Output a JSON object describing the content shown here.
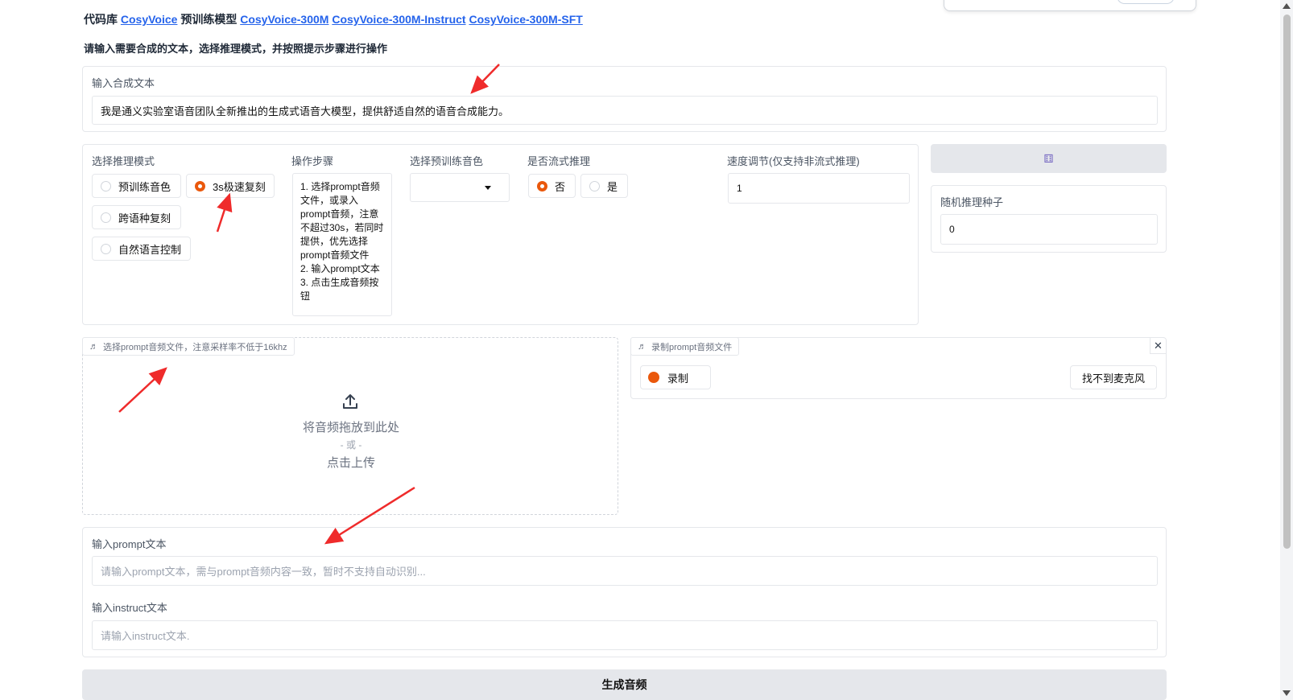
{
  "header": {
    "repo_label": "代码库",
    "repo_link": "CosyVoice",
    "models_label": "预训练模型",
    "model_links": [
      "CosyVoice-300M",
      "CosyVoice-300M-Instruct",
      "CosyVoice-300M-SFT"
    ]
  },
  "subtitle": "请输入需要合成的文本，选择推理模式，并按照提示步骤进行操作",
  "tts_text": {
    "label": "输入合成文本",
    "value": "我是通义实验室语音团队全新推出的生成式语音大模型，提供舒适自然的语音合成能力。"
  },
  "mode": {
    "label": "选择推理模式",
    "options": [
      "预训练音色",
      "3s极速复刻",
      "跨语种复刻",
      "自然语言控制"
    ],
    "selected": "3s极速复刻"
  },
  "steps": {
    "label": "操作步骤",
    "text": "1. 选择prompt音频文件，或录入prompt音频，注意不超过30s，若同时提供，优先选择prompt音频文件\n2. 输入prompt文本\n3. 点击生成音频按钮"
  },
  "voice_select": {
    "label": "选择预训练音色",
    "value": ""
  },
  "stream": {
    "label": "是否流式推理",
    "options": [
      "否",
      "是"
    ],
    "selected": "否"
  },
  "speed": {
    "label": "速度调节(仅支持非流式推理)",
    "value": "1"
  },
  "dice_button": {
    "icon": "dice-icon",
    "glyph": "⚅"
  },
  "seed": {
    "label": "随机推理种子",
    "value": "0"
  },
  "upload": {
    "tag": "选择prompt音频文件，注意采样率不低于16khz",
    "drop_text": "将音频拖放到此处",
    "or_text": "- 或 -",
    "click_text": "点击上传"
  },
  "record": {
    "tag": "录制prompt音频文件",
    "record_label": "录制",
    "mic_label": "找不到麦克风",
    "close_glyph": "✕"
  },
  "prompt_text": {
    "label": "输入prompt文本",
    "placeholder": "请输入prompt文本，需与prompt音频内容一致，暂时不支持自动识别..."
  },
  "instruct_text": {
    "label": "输入instruct文本",
    "placeholder": "请输入instruct文本."
  },
  "generate_button": "生成音频",
  "colors": {
    "accent": "#ea580c",
    "link": "#2563eb",
    "annotation": "#ef2b2b"
  }
}
